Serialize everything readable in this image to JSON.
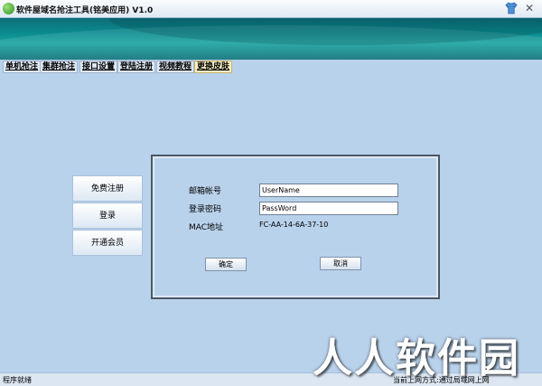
{
  "window": {
    "title": "软件屋域名抢注工具(铭美应用) V1.0",
    "close_glyph": "✕"
  },
  "tabs": [
    {
      "label": "单机抢注"
    },
    {
      "label": "集群抢注"
    },
    {
      "label": "接口设置"
    },
    {
      "label": "登陆注册"
    },
    {
      "label": "视频教程"
    },
    {
      "label": "更换皮肤"
    }
  ],
  "active_tab": "更换皮肤",
  "side_menu": {
    "free_register": "免费注册",
    "login": "登录",
    "open_member": "开通会员"
  },
  "form": {
    "email_label": "邮箱帐号",
    "email_value": "UserName",
    "password_label": "登录密码",
    "password_value": "PassWord",
    "mac_label": "MAC地址",
    "mac_value": "FC-AA-14-6A-37-10",
    "confirm_label": "确定",
    "cancel_label": "取消"
  },
  "status": {
    "left": "程序就绪",
    "right": "当前上网方式:通过局域网上网"
  },
  "watermark": "人人软件园",
  "icons": {
    "app": "green-leaf-icon",
    "skin": "blue-shirt-icon",
    "close": "close-icon"
  },
  "colors": {
    "background": "#b9d2ec",
    "banner": "#0a8a8e",
    "active_tab": "#f7efc6"
  }
}
